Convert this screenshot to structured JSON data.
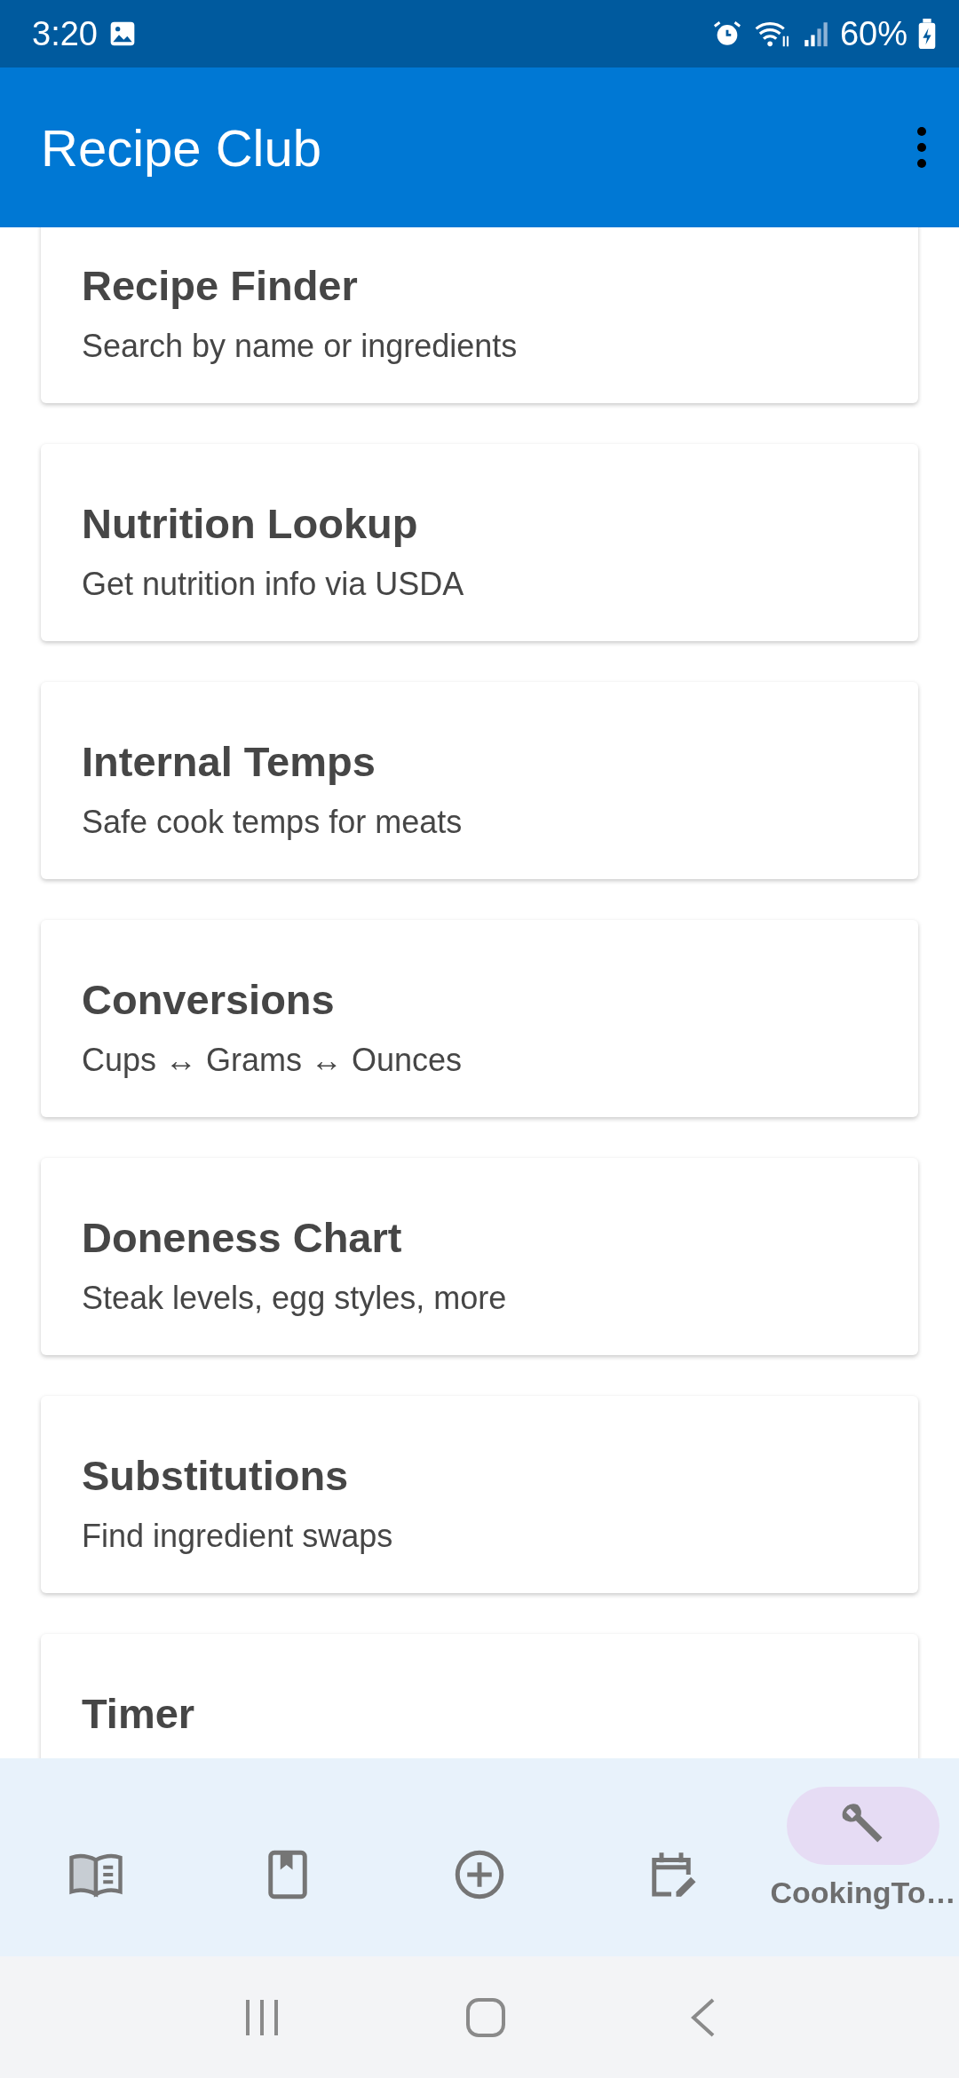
{
  "status_bar": {
    "time": "3:20",
    "battery": "60%"
  },
  "app_bar": {
    "title": "Recipe Club"
  },
  "cards": [
    {
      "title": "Recipe Finder",
      "subtitle": "Search by name or ingredients"
    },
    {
      "title": "Nutrition Lookup",
      "subtitle": "Get nutrition info via USDA"
    },
    {
      "title": "Internal Temps",
      "subtitle": "Safe cook temps for meats"
    },
    {
      "title": "Conversions",
      "subtitle": "Cups ↔ Grams ↔ Ounces"
    },
    {
      "title": "Doneness Chart",
      "subtitle": "Steak levels, egg styles, more"
    },
    {
      "title": "Substitutions",
      "subtitle": "Find ingredient swaps"
    },
    {
      "title": "Timer"
    }
  ],
  "bottom_nav": [
    {
      "kind": "book",
      "selected": false
    },
    {
      "kind": "bookmark",
      "selected": false
    },
    {
      "kind": "add",
      "selected": false
    },
    {
      "kind": "calendar",
      "selected": false
    },
    {
      "kind": "wrench",
      "selected": true,
      "label": "CookingTo…"
    }
  ]
}
